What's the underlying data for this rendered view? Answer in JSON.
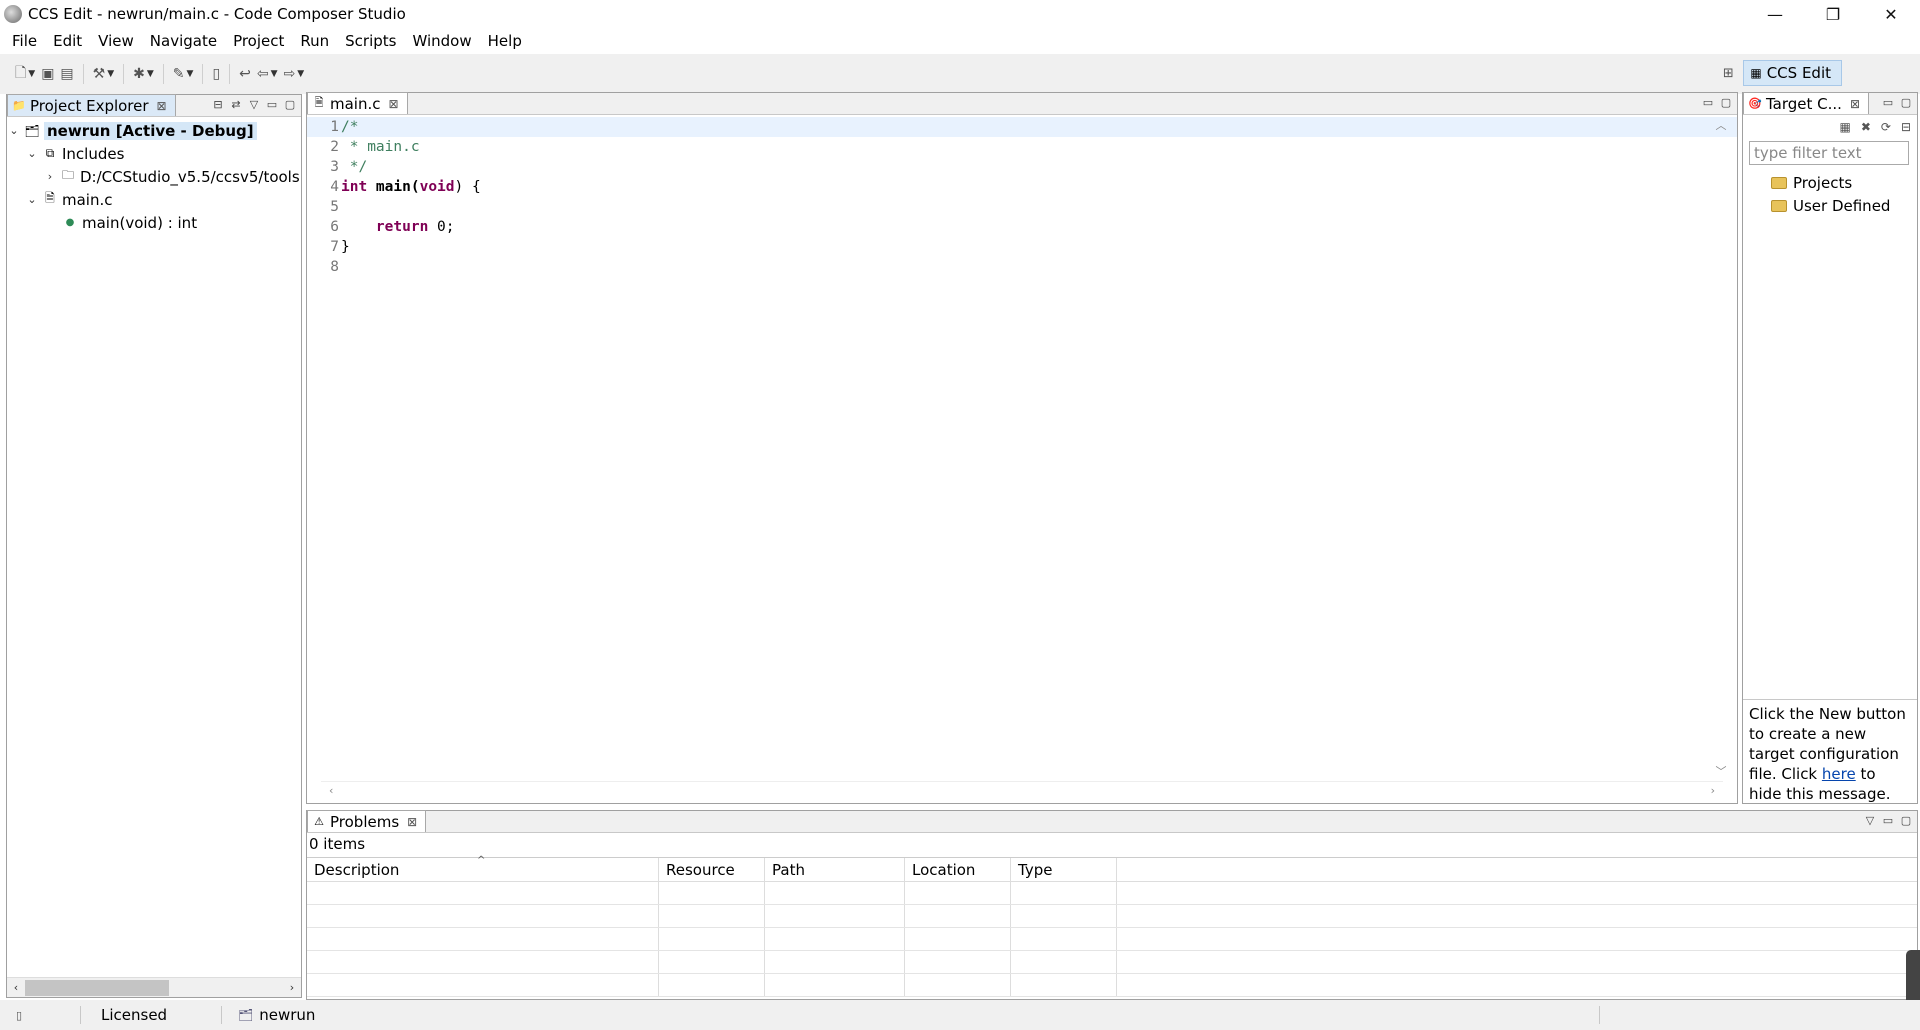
{
  "window": {
    "title": "CCS Edit - newrun/main.c - Code Composer Studio",
    "controls": [
      "—",
      "❐",
      "✕"
    ]
  },
  "menu": [
    "File",
    "Edit",
    "View",
    "Navigate",
    "Project",
    "Run",
    "Scripts",
    "Window",
    "Help"
  ],
  "perspective": {
    "label": "CCS Edit"
  },
  "project_explorer": {
    "tab_label": "Project Explorer",
    "tree": {
      "project_name": "newrun",
      "project_status": "[Active - Debug]",
      "includes_label": "Includes",
      "include_path": "D:/CCStudio_v5.5/ccsv5/tools",
      "file_name": "main.c",
      "function": "main(void) : int"
    }
  },
  "editor": {
    "tab_label": "main.c",
    "lines": [
      {
        "num": "1",
        "text": "/*"
      },
      {
        "num": "2",
        "text": " * main.c"
      },
      {
        "num": "3",
        "text": " */"
      },
      {
        "num": "4",
        "kw1": "int",
        "fn": " main(",
        "kw2": "void",
        "rest": ") {"
      },
      {
        "num": "5",
        "text": ""
      },
      {
        "num": "6",
        "indent": "    ",
        "kw": "return",
        "rest": " 0;"
      },
      {
        "num": "7",
        "text": "}"
      },
      {
        "num": "8",
        "text": ""
      }
    ]
  },
  "target_config": {
    "tab_label": "Target C...",
    "filter_placeholder": "type filter text",
    "folders": [
      "Projects",
      "User Defined"
    ],
    "message_before": "Click the New button to create a new target configuration file. Click ",
    "message_link": "here",
    "message_after": " to hide this message."
  },
  "problems": {
    "tab_label": "Problems",
    "count": "0 items",
    "columns": [
      "Description",
      "Resource",
      "Path",
      "Location",
      "Type"
    ]
  },
  "status_bar": {
    "license": "Licensed",
    "project": "newrun"
  }
}
